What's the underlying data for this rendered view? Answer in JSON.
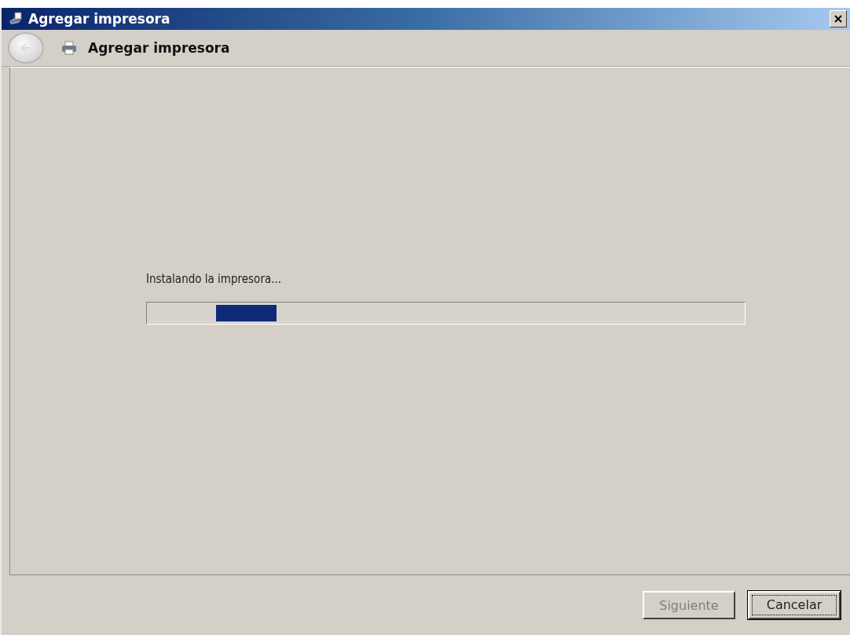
{
  "window": {
    "title": "Agregar impresora"
  },
  "header": {
    "title": "Agregar impresora",
    "back_disabled": true
  },
  "status": {
    "text": "Instalando la impresora..."
  },
  "progress": {
    "indeterminate": true
  },
  "buttons": [
    {
      "label": "Siguiente",
      "disabled": true,
      "focused": false
    },
    {
      "label": "Cancelar",
      "disabled": false,
      "focused": true
    }
  ]
}
